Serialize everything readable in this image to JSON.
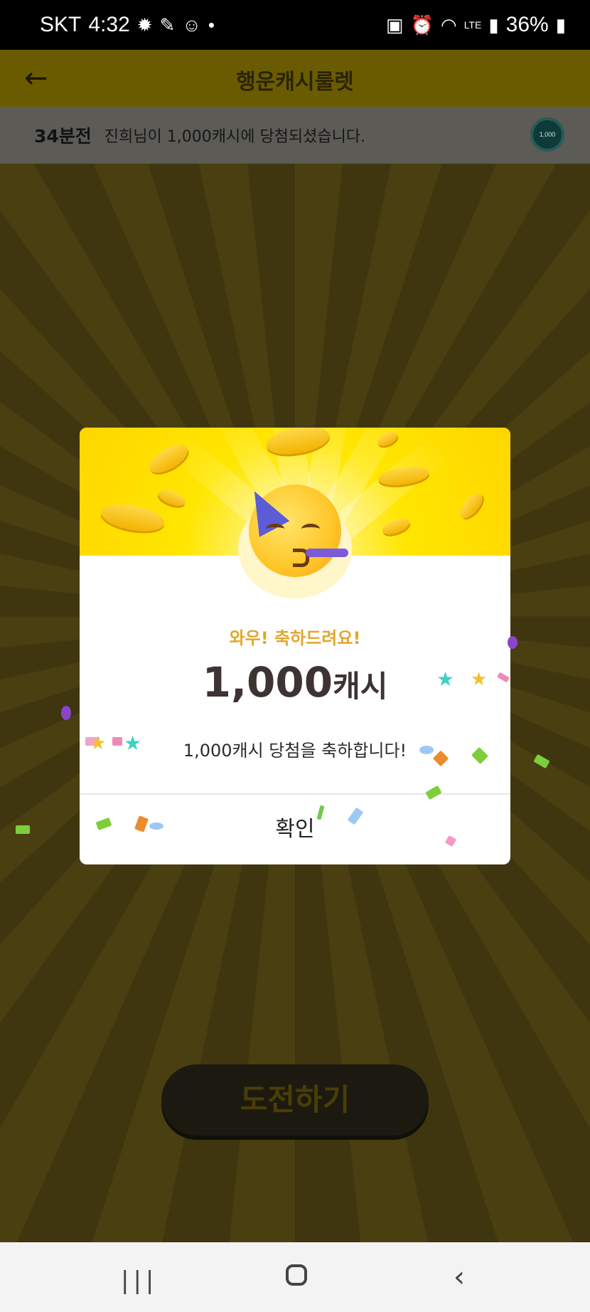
{
  "status_bar": {
    "carrier": "SKT",
    "time": "4:32",
    "network": "LTE",
    "battery": "36%",
    "icons": [
      "gear-icon",
      "clip-icon",
      "face-icon",
      "dot-icon",
      "battery-saver-icon",
      "alarm-icon",
      "wifi-icon",
      "signal-icon",
      "battery-icon"
    ]
  },
  "app_bar": {
    "title": "행운캐시룰렛",
    "back_icon": "arrow-left-icon"
  },
  "ticker": {
    "time_ago": "34분전",
    "message": "진희님이 1,000캐시에 당첨되셨습니다.",
    "coin_label": "1,000"
  },
  "modal": {
    "headline": "와우! 축하드려요!",
    "amount": "1,000",
    "amount_unit": "캐시",
    "message": "1,000캐시 당첨을 축하합니다!",
    "confirm_label": "확인",
    "emoji": "partying-face-icon"
  },
  "background_button": {
    "label": "도전하기"
  },
  "colors": {
    "accent_yellow": "#ffe600",
    "headline_orange": "#e3a62c",
    "amount_text": "#3d3333",
    "overlay_bg": "#3a3214"
  },
  "nav_bar": {
    "icons": [
      "recents-icon",
      "home-icon",
      "back-icon"
    ]
  }
}
